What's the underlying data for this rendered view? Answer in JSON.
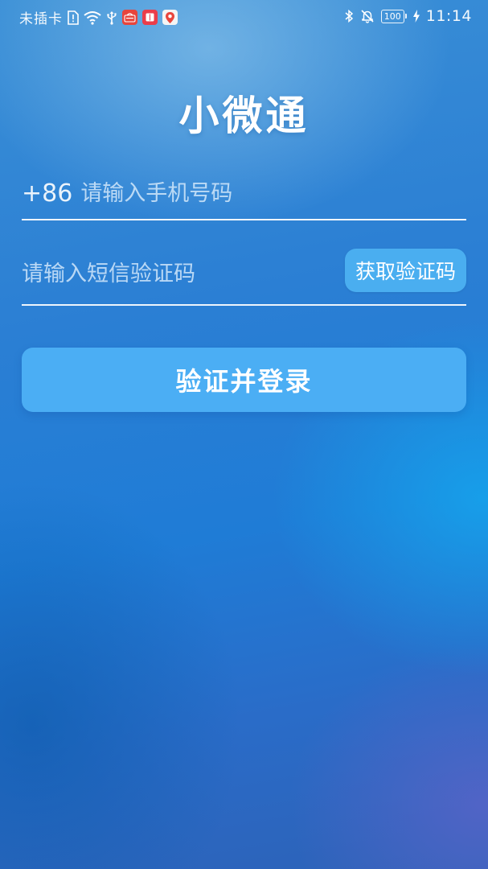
{
  "status_bar": {
    "carrier": "未插卡",
    "battery_level": "100",
    "time": "11:14",
    "icons_left": [
      "sim-alert-icon",
      "wifi-icon",
      "usb-icon",
      "app-notification-red-icon",
      "app-notification-book-icon",
      "app-notification-map-icon"
    ],
    "icons_right": [
      "bluetooth-icon",
      "mute-bell-icon",
      "battery-icon",
      "charging-icon"
    ]
  },
  "app": {
    "title": "小微通"
  },
  "phone_field": {
    "country_code": "+86",
    "placeholder": "请输入手机号码",
    "value": ""
  },
  "code_field": {
    "placeholder": "请输入短信验证码",
    "value": "",
    "get_code_label": "获取验证码"
  },
  "login_button": {
    "label": "验证并登录"
  },
  "colors": {
    "button": "#4baef4",
    "background_top": "#3a8fd6",
    "background_bottom": "#2d62b8"
  }
}
